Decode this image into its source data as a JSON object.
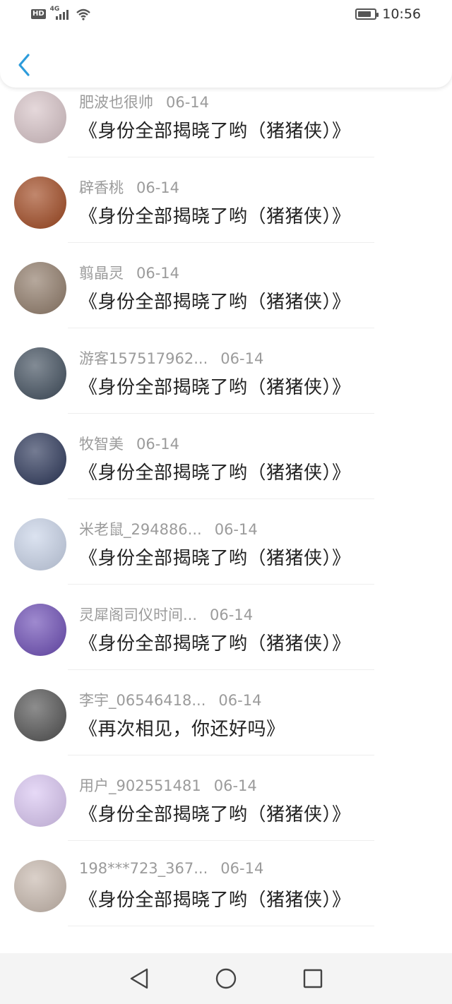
{
  "status_bar": {
    "time": "10:56",
    "network": "4G",
    "hd_label": "HD"
  },
  "nav": {
    "back_icon": "chevron-left-icon",
    "accent": "#2d9cdb"
  },
  "comments": [
    {
      "name": "",
      "date": "",
      "text": "",
      "partial": true,
      "avatar_color": "#3a3a3a"
    },
    {
      "name": "肥波也很帅",
      "date": "06-14",
      "text": "《身份全部揭晓了哟（猪猪侠）》",
      "avatar_color": "#d7c3c7"
    },
    {
      "name": "辟香桃",
      "date": "06-14",
      "text": "《身份全部揭晓了哟（猪猪侠）》",
      "avatar_color": "#a0471f"
    },
    {
      "name": "翦晶灵",
      "date": "06-14",
      "text": "《身份全部揭晓了哟（猪猪侠）》",
      "avatar_color": "#8f7a68"
    },
    {
      "name": "游客157517962...",
      "date": "06-14",
      "text": "《身份全部揭晓了哟（猪猪侠）》",
      "avatar_color": "#3f4d5c"
    },
    {
      "name": "牧智美",
      "date": "06-14",
      "text": "《身份全部揭晓了哟（猪猪侠）》",
      "avatar_color": "#2a3558"
    },
    {
      "name": "米老鼠_294886...",
      "date": "06-14",
      "text": "《身份全部揭晓了哟（猪猪侠）》",
      "avatar_color": "#c8d3e8"
    },
    {
      "name": "灵犀阁司仪时间...",
      "date": "06-14",
      "text": "《身份全部揭晓了哟（猪猪侠）》",
      "avatar_color": "#6b4bb5"
    },
    {
      "name": "李宇_06546418...",
      "date": "06-14",
      "text": "《再次相见，你还好吗》",
      "avatar_color": "#505050"
    },
    {
      "name": "用户_902551481",
      "date": "06-14",
      "text": "《身份全部揭晓了哟（猪猪侠）》",
      "avatar_color": "#d9c5f2"
    },
    {
      "name": "198***723_367...",
      "date": "06-14",
      "text": "《身份全部揭晓了哟（猪猪侠）》",
      "avatar_color": "#c7b8ad"
    }
  ],
  "bottom_nav": {
    "back": "triangle-back-icon",
    "home": "circle-home-icon",
    "recents": "square-recents-icon"
  }
}
